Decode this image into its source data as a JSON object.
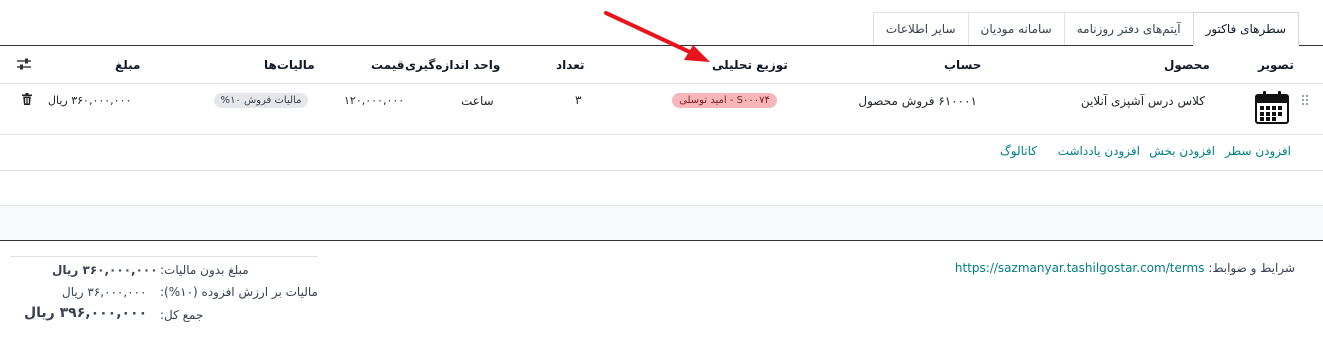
{
  "tabs": [
    {
      "label": "سطرهای فاکتور",
      "active": true
    },
    {
      "label": "آیتم‌های دفتر روزنامه",
      "active": false
    },
    {
      "label": "سامانه مودیان",
      "active": false
    },
    {
      "label": "سایر اطلاعات",
      "active": false
    }
  ],
  "table": {
    "headers": {
      "image": "تصویر",
      "product": "محصول",
      "account": "حساب",
      "analytic": "توزیع تحلیلی",
      "quantity": "تعداد",
      "uom": "واحد اندازه‌گیری",
      "price": "قیمت",
      "taxes": "مالیات‌ها",
      "amount": "مبلغ"
    },
    "rows": [
      {
        "product": "کلاس درس آشپزی آنلاین",
        "account": "۶۱۰۰۰۱ فروش محصول",
        "analytic": "S۰۰۰۷۴ - امید توسلی",
        "quantity": "۳",
        "uom": "ساعت",
        "price": "۱۲۰,۰۰۰,۰۰۰",
        "taxes": "مالیات فروش ۱۰%",
        "amount": "۳۶۰,۰۰۰,۰۰۰ ریال"
      }
    ],
    "actions": {
      "add_line": "افزودن سطر",
      "add_section": "افزودن بخش",
      "add_note": "افزودن یادداشت",
      "catalog": "کاتالوگ"
    }
  },
  "footer": {
    "terms_label": "شرایط و ضوابط:",
    "terms_url": "https://sazmanyar.tashilgostar.com/terms",
    "untaxed_label": "مبلغ بدون مالیات:",
    "untaxed_value": "۳۶۰,۰۰۰,۰۰۰ ریال",
    "vat_label": "مالیات بر ارزش افزوده (۱۰%):",
    "vat_value": "۳۶,۰۰۰,۰۰۰ ریال",
    "total_label": "جمع کل:",
    "total_value": "۳۹۶,۰۰۰,۰۰۰ ریال"
  },
  "colors": {
    "accent": "#017e84",
    "badge_red": "#f8b6bb",
    "arrow": "#e8141b"
  }
}
